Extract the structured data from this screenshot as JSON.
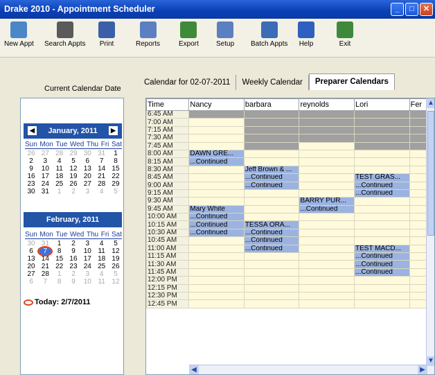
{
  "window": {
    "title": "Drake 2010 - Appointment Scheduler"
  },
  "toolbar": [
    {
      "label": "New Appt",
      "icon": "new-appt-icon"
    },
    {
      "label": "Search Appts",
      "icon": "binoculars-icon"
    },
    {
      "label": "Print",
      "icon": "printer-icon"
    },
    {
      "label": "Reports",
      "icon": "reports-icon"
    },
    {
      "label": "Export",
      "icon": "export-icon"
    },
    {
      "label": "Setup",
      "icon": "setup-icon"
    },
    {
      "label": "Batch Appts",
      "icon": "batch-icon"
    },
    {
      "label": "Help",
      "icon": "help-icon"
    },
    {
      "label": "Exit",
      "icon": "exit-icon"
    }
  ],
  "left": {
    "current_label": "Current Calendar Date",
    "jan": {
      "title": "January, 2011"
    },
    "feb": {
      "title": "February, 2011"
    },
    "dow": [
      "Sun",
      "Mon",
      "Tue",
      "Wed",
      "Thu",
      "Fri",
      "Sat"
    ],
    "today": "Today: 2/7/2011"
  },
  "tabs": [
    "Calendar for 02-07-2011",
    "Weekly Calendar",
    "Preparer Calendars"
  ],
  "grid": {
    "headers": [
      "Time",
      "Nancy",
      "barbara",
      "reynolds",
      "Lori",
      "Fer"
    ],
    "times": [
      "6:45 AM",
      "7:00 AM",
      "7:15 AM",
      "7:30 AM",
      "7:45 AM",
      "8:00 AM",
      "8:15 AM",
      "8:30 AM",
      "8:45 AM",
      "9:00 AM",
      "9:15 AM",
      "9:30 AM",
      "9:45 AM",
      "10:00 AM",
      "10:15 AM",
      "10:30 AM",
      "10:45 AM",
      "11:00 AM",
      "11:15 AM",
      "11:30 AM",
      "11:45 AM",
      "12:00 PM",
      "12:15 PM",
      "12:30 PM",
      "12:45 PM"
    ],
    "appointments": {
      "Nancy": {
        "8:00 AM": "DAWN GRE...",
        "8:15 AM": "...Continued",
        "9:45 AM": "Mary White",
        "10:00 AM": "...Continued",
        "10:15 AM": "...Continued",
        "10:30 AM": "...Continued"
      },
      "barbara": {
        "8:30 AM": "Jeff Brown & ...",
        "8:45 AM": "...Continued",
        "9:00 AM": "...Continued",
        "10:15 AM": "TESSA ORA...",
        "10:30 AM": "...Continued",
        "10:45 AM": "...Continued",
        "11:00 AM": "...Continued"
      },
      "reynolds": {
        "9:30 AM": "BARRY PUR...",
        "9:45 AM": "...Continued"
      },
      "Lori": {
        "8:45 AM": "TEST GRAS...",
        "9:00 AM": "...Continued",
        "9:15 AM": "...Continued",
        "11:00 AM": "TEST MACD...",
        "11:15 AM": "...Continued",
        "11:30 AM": "...Continued",
        "11:45 AM": "...Continued"
      }
    },
    "blocked_rows_all": [
      "6:45 AM",
      "7:00 AM",
      "7:15 AM",
      "7:30 AM"
    ],
    "blocked_rows_partial": [
      "7:45 AM"
    ]
  },
  "colors": {
    "title_bar": "#0a3fb5",
    "appointment": "#9bb3e0",
    "empty_slot": "#fffadc",
    "blocked": "#a0a0a0",
    "cal_header": "#2254a8"
  }
}
